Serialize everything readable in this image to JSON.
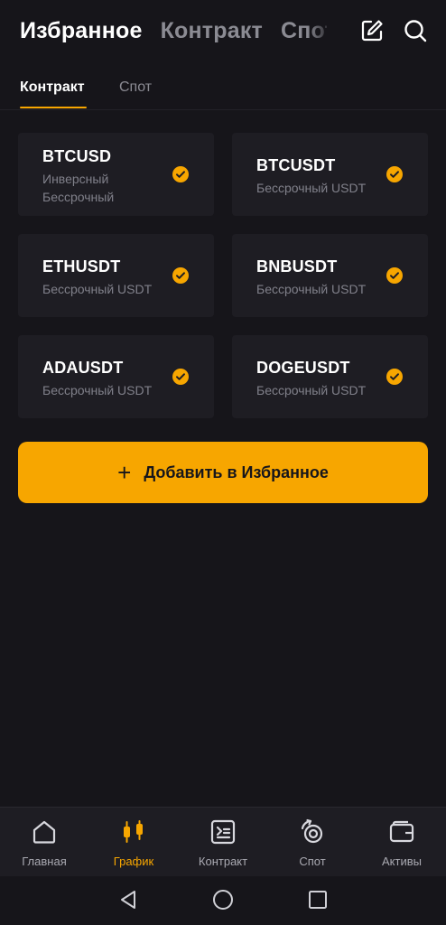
{
  "header": {
    "tabs": [
      {
        "label": "Избранное",
        "active": true
      },
      {
        "label": "Контракт",
        "active": false
      },
      {
        "label": "Спот",
        "active": false
      }
    ],
    "icons": [
      "edit-icon",
      "search-icon"
    ]
  },
  "subtabs": [
    {
      "label": "Контракт",
      "active": true
    },
    {
      "label": "Спот",
      "active": false
    }
  ],
  "favorites": [
    {
      "symbol": "BTCUSD",
      "sub1": "Инверсный",
      "sub2": "Бессрочный",
      "selected": true
    },
    {
      "symbol": "BTCUSDT",
      "sub1": "Бессрочный USDT",
      "selected": true
    },
    {
      "symbol": "ETHUSDT",
      "sub1": "Бессрочный USDT",
      "selected": true
    },
    {
      "symbol": "BNBUSDT",
      "sub1": "Бессрочный USDT",
      "selected": true
    },
    {
      "symbol": "ADAUSDT",
      "sub1": "Бессрочный USDT",
      "selected": true
    },
    {
      "symbol": "DOGEUSDT",
      "sub1": "Бессрочный USDT",
      "selected": true
    }
  ],
  "add_button": {
    "plus": "+",
    "label": "Добавить в Избранное"
  },
  "bottom_nav": [
    {
      "label": "Главная",
      "icon": "home-icon",
      "active": false
    },
    {
      "label": "График",
      "icon": "candlestick-icon",
      "active": true
    },
    {
      "label": "Контракт",
      "icon": "contract-icon",
      "active": false
    },
    {
      "label": "Спот",
      "icon": "spot-icon",
      "active": false
    },
    {
      "label": "Активы",
      "icon": "wallet-icon",
      "active": false
    }
  ],
  "colors": {
    "background": "#16151a",
    "card": "#1e1d23",
    "accent": "#f7a600",
    "muted_text": "#80808a"
  }
}
